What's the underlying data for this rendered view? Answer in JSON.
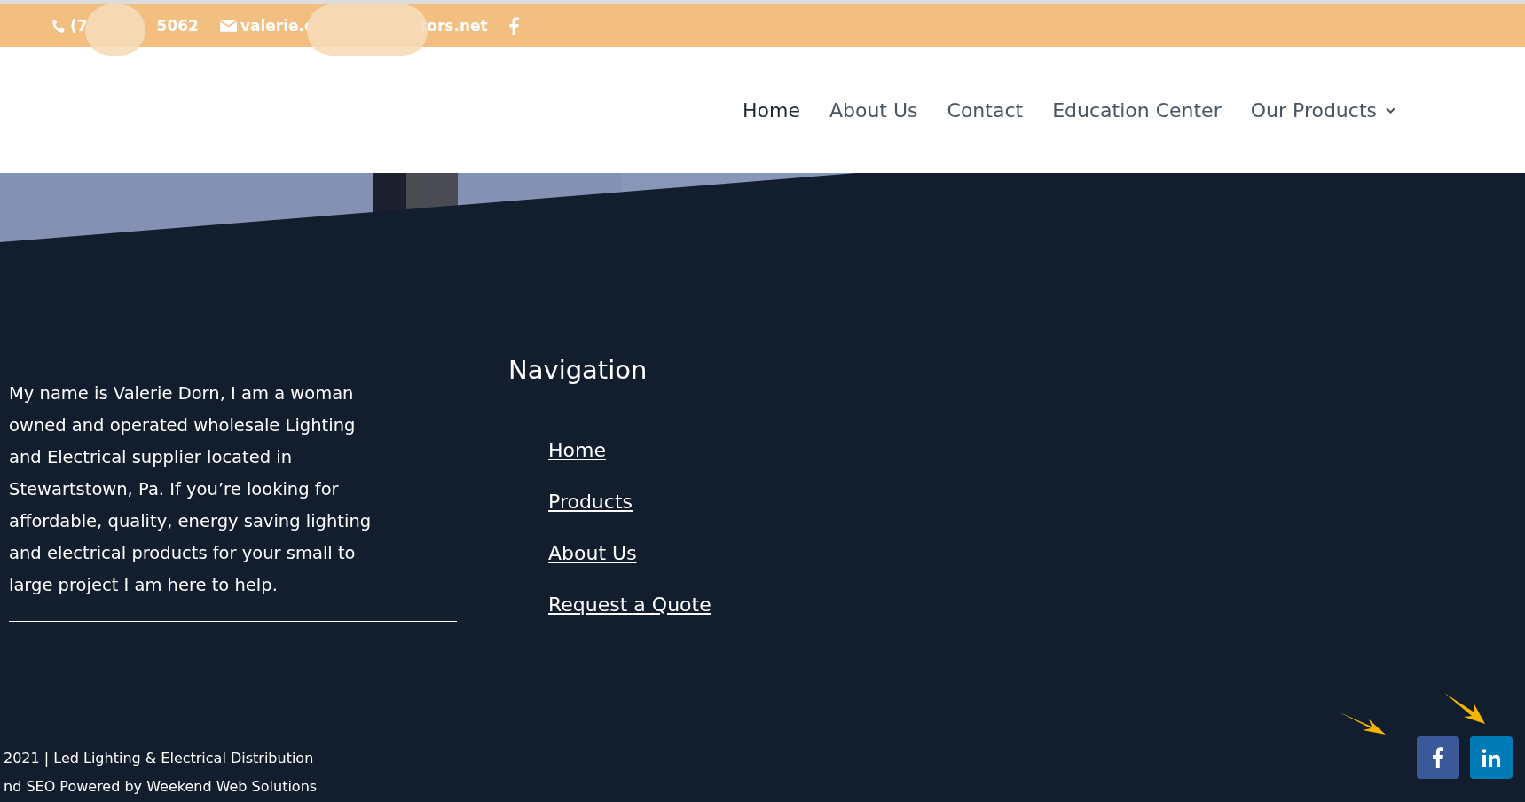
{
  "top_bar": {
    "phone_parts": [
      "(7",
      "5062"
    ],
    "email_parts": [
      "valerie.c",
      "tors.net"
    ]
  },
  "nav": {
    "items": [
      {
        "label": "Home",
        "selected": true,
        "dropdown": false
      },
      {
        "label": "About Us",
        "selected": false,
        "dropdown": false
      },
      {
        "label": "Contact",
        "selected": false,
        "dropdown": false
      },
      {
        "label": "Education Center",
        "selected": false,
        "dropdown": false
      },
      {
        "label": "Our Products",
        "selected": false,
        "dropdown": true
      }
    ]
  },
  "footer": {
    "about": "My name is Valerie Dorn, I am a woman owned and operated wholesale Lighting and Electrical supplier located in Stewartstown, Pa. If you’re looking for affordable, quality, energy saving lighting and electrical products for your small to large project I am here to help.",
    "navigation_title": "Navigation",
    "links": [
      "Home",
      "Products",
      "About Us",
      "Request a Quote"
    ],
    "copyright": "2021 | Led Lighting & Electrical Distribution",
    "credit": "nd SEO Powered by Weekend Web Solutions"
  },
  "social": [
    {
      "kind": "facebook",
      "color": "#3b5998"
    },
    {
      "kind": "linkedin",
      "color": "#007bb5"
    }
  ]
}
